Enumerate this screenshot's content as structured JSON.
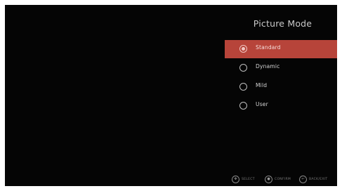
{
  "menu": {
    "title": "Picture Mode",
    "options": [
      {
        "label": "Standard",
        "selected": true
      },
      {
        "label": "Dynamic",
        "selected": false
      },
      {
        "label": "Mild",
        "selected": false
      },
      {
        "label": "User",
        "selected": false
      }
    ]
  },
  "hints": [
    {
      "icon": "dpad-icon",
      "label": "SELECT"
    },
    {
      "icon": "ok-button-icon",
      "label": "CONFIRM"
    },
    {
      "icon": "back-icon",
      "label": "BACK/EXIT"
    }
  ],
  "colors": {
    "background": "#050505",
    "selected_highlight": "#b7443a",
    "text": "#d6d6d6"
  }
}
